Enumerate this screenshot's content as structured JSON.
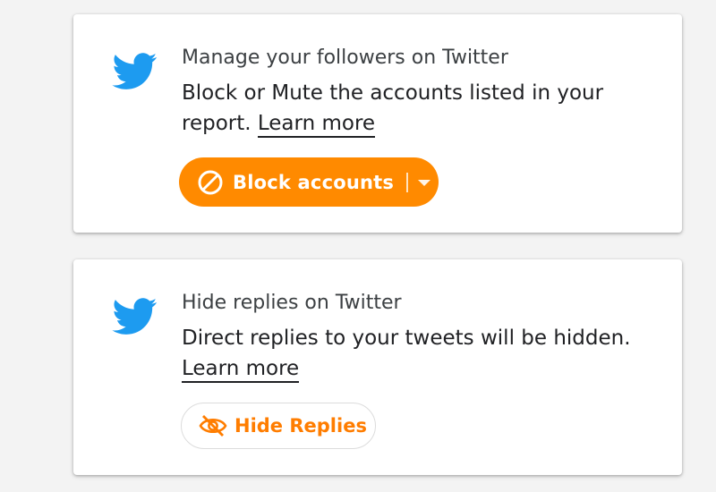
{
  "colors": {
    "twitter_blue": "#1d9bf0",
    "accent_orange": "#ff8a00",
    "hide_orange": "#ff7d00"
  },
  "cards": {
    "followers": {
      "icon": "twitter-bird-icon",
      "title": "Manage your followers on Twitter",
      "description": "Block or Mute the accounts listed in your report.",
      "learn_more": "Learn more",
      "button_label": "Block accounts",
      "button_icon": "block-icon",
      "dropdown_icon": "caret-down-icon"
    },
    "replies": {
      "icon": "twitter-bird-icon",
      "title": "Hide replies on Twitter",
      "description": "Direct replies to your tweets will be hidden.",
      "learn_more": "Learn more",
      "button_label": "Hide Replies",
      "button_icon": "eye-off-icon"
    }
  }
}
